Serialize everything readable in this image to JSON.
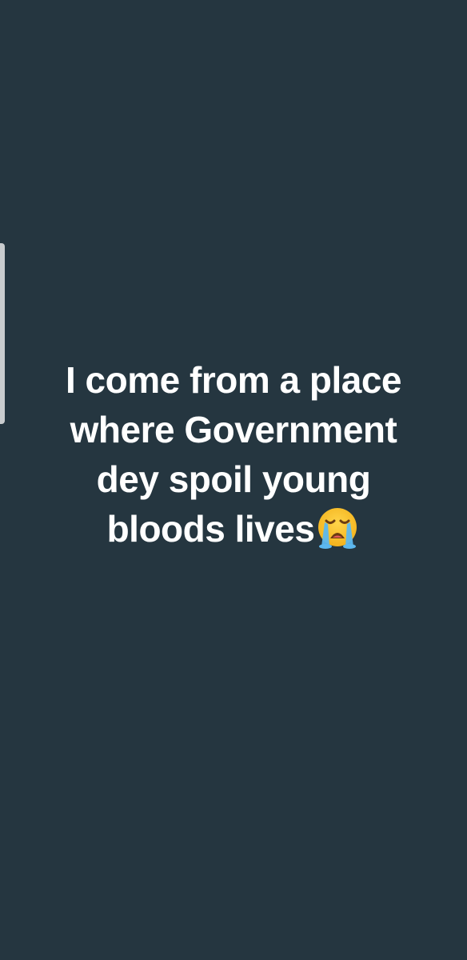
{
  "status": {
    "lines": [
      "I come from a place",
      "where Government",
      "dey spoil young",
      "bloods lives"
    ],
    "emoji": "loudly-crying-face-icon"
  },
  "colors": {
    "background": "#253640",
    "text": "#ffffff",
    "handle": "#c9ccce"
  }
}
